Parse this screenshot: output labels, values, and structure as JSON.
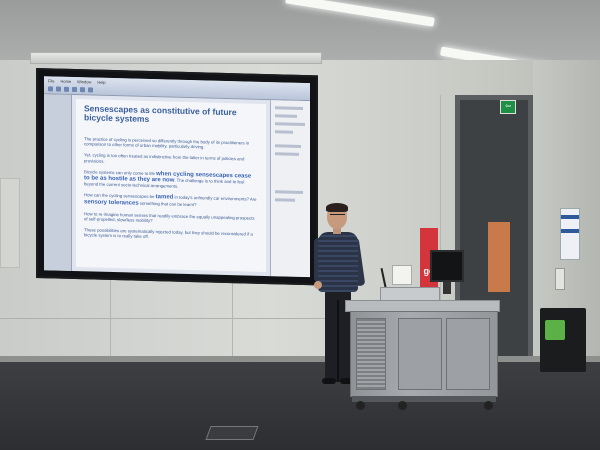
{
  "slide": {
    "title": "Sensescapes as constitutive of future bicycle systems",
    "paragraphs": [
      {
        "text": "The practice of cycling is perceived so differently through the body of its practitioners in comparison to other forms of urban mobility, particularly driving."
      },
      {
        "text": "Yet, cycling is too often treated as indistinctive from the latter in terms of policies and provisions."
      },
      {
        "pre": "Bicycle systems can only come to life ",
        "em": "when cycling sensescapes cease to be as hostile as they are now",
        "post": ". The challenge is to think and to feel beyond the current socio-technical arrangements."
      },
      {
        "pre": "How can the cycling sensescapes be ",
        "em": "tamed",
        "post": " in today's unfriendly car environments? Are ",
        "em2": "sensory tolerances",
        "post2": " something that can be learnt?"
      },
      {
        "text": "How to re-imagine human senses that readily embrace the equally unappealing prospects of self-propelled, slow/less mobility?"
      },
      {
        "text": "These possibilities are systematically rejected today, but they should be reconsidered if a bicycle system is to really take off."
      }
    ]
  },
  "app": {
    "menu": [
      "File",
      "Home",
      "Window",
      "Help"
    ]
  },
  "signage": {
    "exit": "⇦",
    "banner": "go"
  },
  "colors": {
    "slide_text": "#3b5a92",
    "slide_emphasis": "#3a64b5",
    "banner_red": "#d4343b",
    "exit_green": "#1e8f45"
  }
}
